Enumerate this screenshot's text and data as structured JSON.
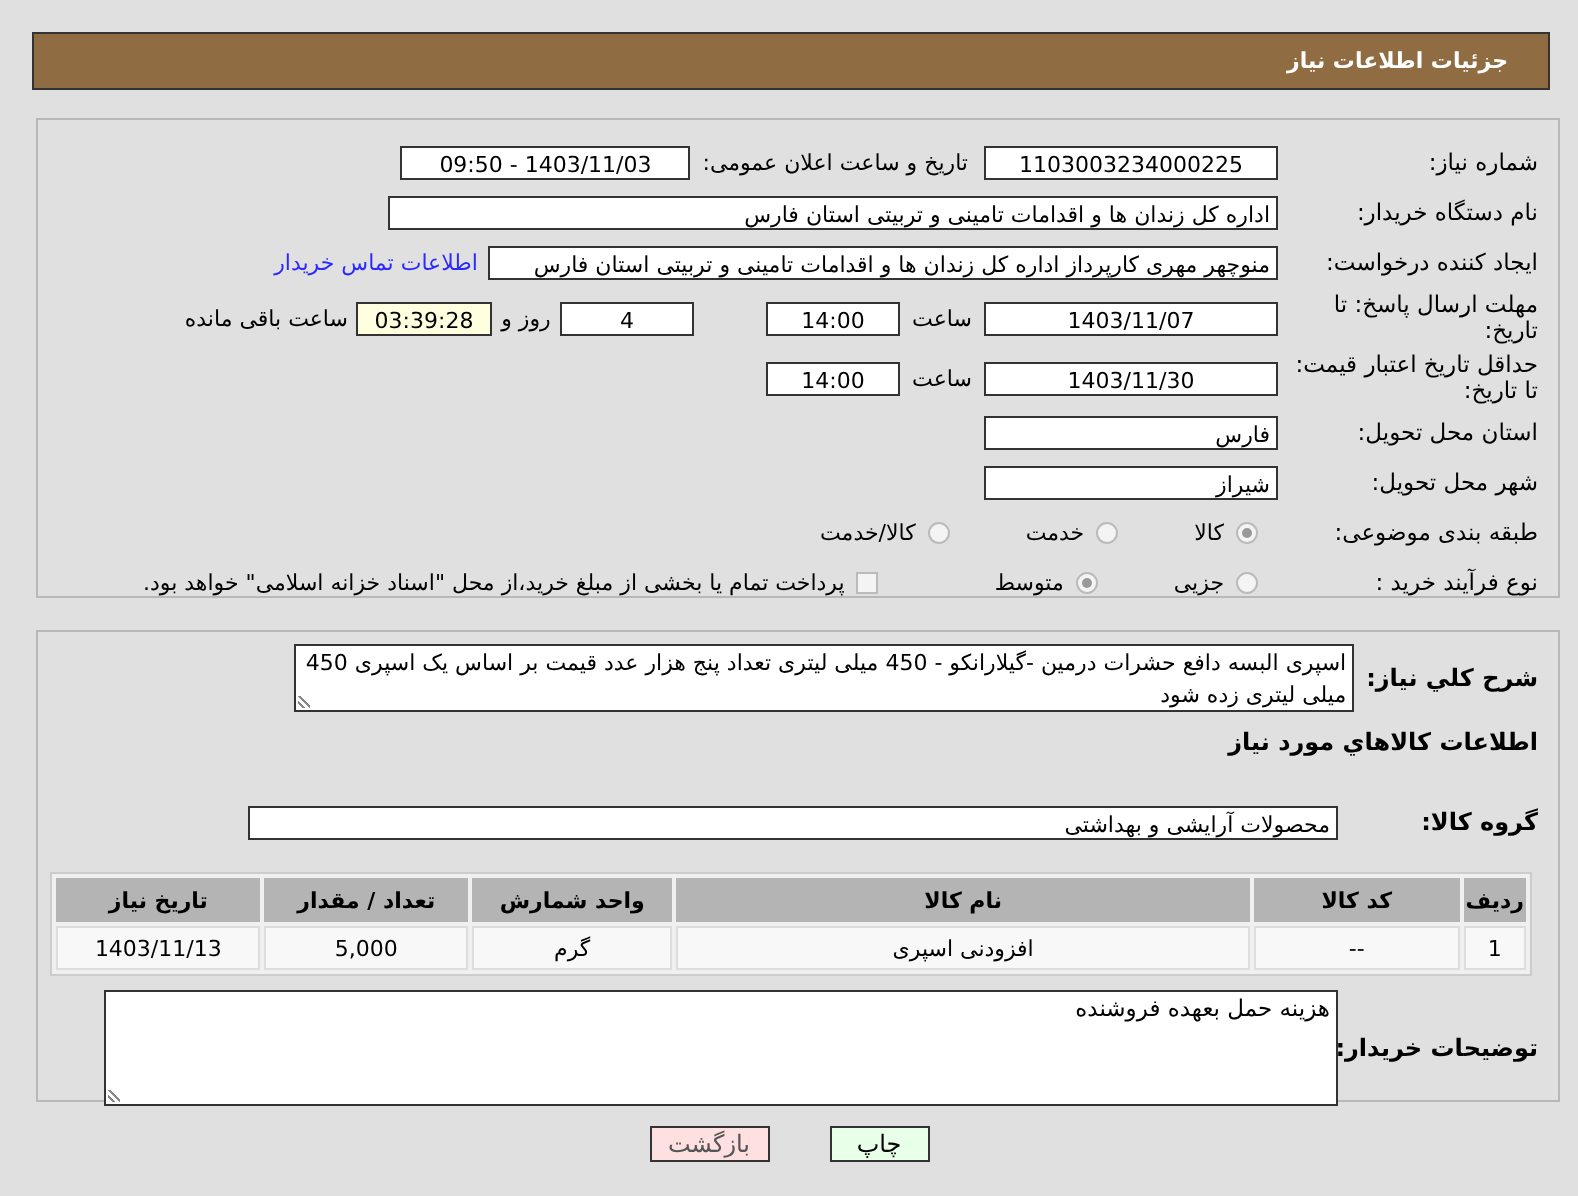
{
  "header": {
    "title": "جزئیات اطلاعات نیاز"
  },
  "need_number": {
    "label": "شماره نیاز:",
    "value": "1103003234000225"
  },
  "announce": {
    "label": "تاریخ و ساعت اعلان عمومی:",
    "value": "1403/11/03 - 09:50"
  },
  "buyer_org": {
    "label": "نام دستگاه خریدار:",
    "value": "اداره کل زندان ها و اقدامات تامینی و تربیتی استان فارس"
  },
  "requester": {
    "label": "ایجاد کننده درخواست:",
    "value": "منوچهر  مهری  کارپرداز اداره کل زندان ها و اقدامات تامینی و تربیتی استان فارس",
    "link": "اطلاعات تماس خریدار"
  },
  "deadline": {
    "label": "مهلت ارسال پاسخ: تا تاریخ:",
    "date": "1403/11/07",
    "time_label": "ساعت",
    "time": "14:00",
    "days": "4",
    "days_label": "روز و",
    "remaining": "03:39:28",
    "remaining_label": "ساعت باقی مانده"
  },
  "validity": {
    "label": "حداقل تاریخ اعتبار قیمت: تا تاریخ:",
    "date": "1403/11/30",
    "time_label": "ساعت",
    "time": "14:00"
  },
  "province": {
    "label": "استان محل تحویل:",
    "value": "فارس"
  },
  "city": {
    "label": "شهر محل تحویل:",
    "value": "شیراز"
  },
  "category": {
    "label": "طبقه بندی موضوعی:",
    "options": [
      {
        "label": "کالا",
        "selected": true
      },
      {
        "label": "خدمت",
        "selected": false
      },
      {
        "label": "کالا/خدمت",
        "selected": false
      }
    ]
  },
  "process": {
    "label": "نوع فرآیند خرید :",
    "options": [
      {
        "label": "جزیی",
        "selected": false
      },
      {
        "label": "متوسط",
        "selected": true
      }
    ],
    "treasury": {
      "label": "پرداخت تمام یا بخشی از مبلغ خرید،از محل \"اسناد خزانه اسلامی\" خواهد بود.",
      "checked": false
    }
  },
  "description": {
    "label": "شرح کلي نياز:",
    "value": "اسپری البسه دافع حشرات درمین -گیلارانکو - 450 میلی لیتری تعداد پنج هزار عدد قیمت بر اساس یک اسپری 450 میلی لیتری زده شود"
  },
  "goods_title": "اطلاعات كالاهاي مورد نياز",
  "goods_group": {
    "label": "گروه کالا:",
    "value": "محصولات آرایشی و بهداشتی"
  },
  "table": {
    "columns": [
      "ردیف",
      "کد کالا",
      "نام کالا",
      "واحد شمارش",
      "تعداد / مقدار",
      "تاریخ نیاز"
    ],
    "rows": [
      [
        "1",
        "--",
        "افزودنی اسپری",
        "گرم",
        "5,000",
        "1403/11/13"
      ]
    ]
  },
  "buyer_notes": {
    "label": "توضیحات خریدار:",
    "value": "هزینه حمل بعهده فروشنده"
  },
  "buttons": [
    {
      "label": "چاپ",
      "kind": "print"
    },
    {
      "label": "بازگشت",
      "kind": "back"
    }
  ]
}
